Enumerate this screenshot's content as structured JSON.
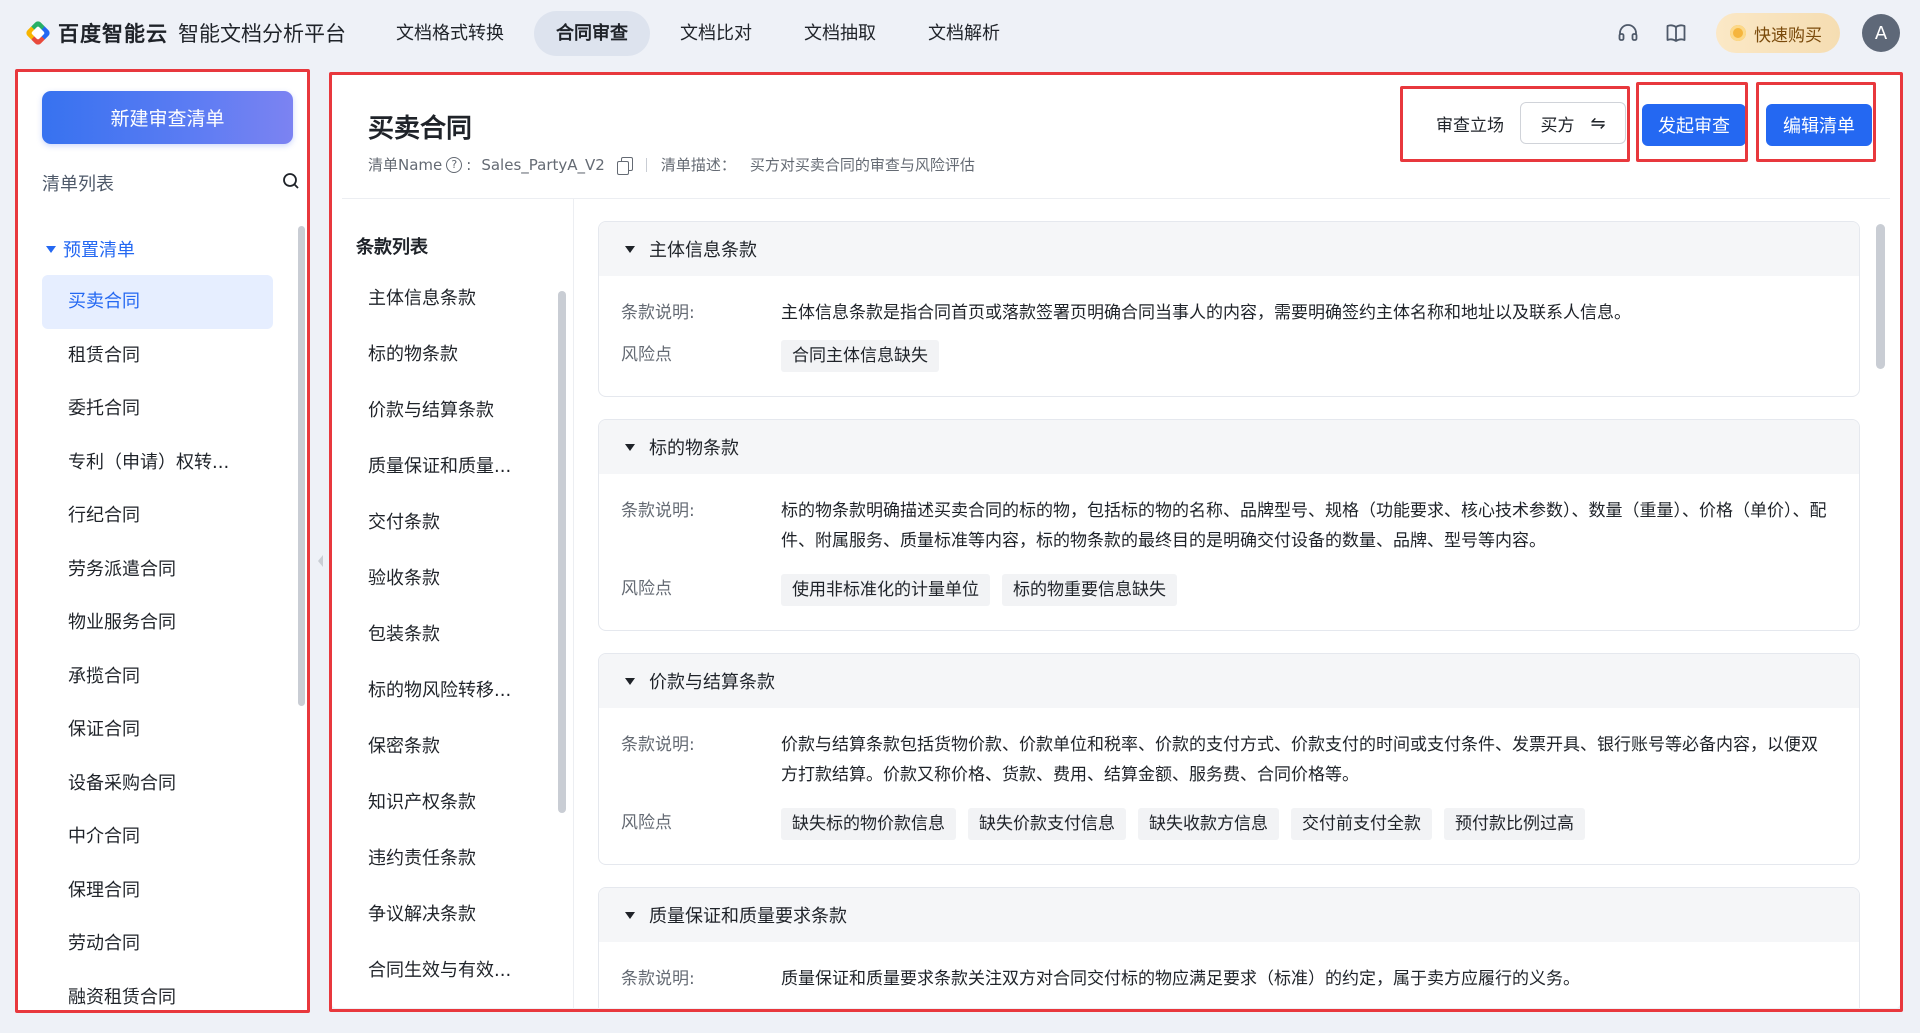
{
  "brand": {
    "name": "百度智能云",
    "product": "智能文档分析平台"
  },
  "nav": [
    "文档格式转换",
    "合同审查",
    "文档比对",
    "文档抽取",
    "文档解析"
  ],
  "top_right": {
    "buy_label": "快速购买",
    "avatar_letter": "A"
  },
  "sidebar": {
    "new_button": "新建审查清单",
    "list_title": "清单列表",
    "group": "预置清单",
    "items": [
      "买卖合同",
      "租赁合同",
      "委托合同",
      "专利（申请）权转...",
      "行纪合同",
      "劳务派遣合同",
      "物业服务合同",
      "承揽合同",
      "保证合同",
      "设备采购合同",
      "中介合同",
      "保理合同",
      "劳动合同",
      "融资租赁合同"
    ]
  },
  "main": {
    "title": "买卖合同",
    "name_label": "清单Name",
    "name_value": "Sales_PartyA_V2",
    "desc_label": "清单描述：",
    "desc_value": "买方对买卖合同的审查与风险评估",
    "stance_label": "审查立场",
    "stance_value": "买方",
    "stance_switch": "⇋",
    "review_button": "发起审查",
    "edit_button": "编辑清单"
  },
  "clause_nav": {
    "title": "条款列表",
    "items": [
      "主体信息条款",
      "标的物条款",
      "价款与结算条款",
      "质量保证和质量...",
      "交付条款",
      "验收条款",
      "包装条款",
      "标的物风险转移...",
      "保密条款",
      "知识产权条款",
      "违约责任条款",
      "争议解决条款",
      "合同生效与有效..."
    ]
  },
  "labels": {
    "desc": "条款说明:",
    "risk": "风险点"
  },
  "clauses": [
    {
      "title": "主体信息条款",
      "desc": "主体信息条款是指合同首页或落款签署页明确合同当事人的内容，需要明确签约主体名称和地址以及联系人信息。",
      "risks": [
        "合同主体信息缺失"
      ]
    },
    {
      "title": "标的物条款",
      "desc": "标的物条款明确描述买卖合同的标的物，包括标的物的名称、品牌型号、规格（功能要求、核心技术参数）、数量（重量）、价格（单价）、配件、附属服务、质量标准等内容，标的物条款的最终目的是明确交付设备的数量、品牌、型号等内容。",
      "risks": [
        "使用非标准化的计量单位",
        "标的物重要信息缺失"
      ]
    },
    {
      "title": "价款与结算条款",
      "desc": "价款与结算条款包括货物价款、价款单位和税率、价款的支付方式、价款支付的时间或支付条件、发票开具、银行账号等必备内容，以便双方打款结算。价款又称价格、货款、费用、结算金额、服务费、合同价格等。",
      "risks": [
        "缺失标的物价款信息",
        "缺失价款支付信息",
        "缺失收款方信息",
        "交付前支付全款",
        "预付款比例过高"
      ]
    },
    {
      "title": "质量保证和质量要求条款",
      "desc": "质量保证和质量要求条款关注双方对合同交付标的物应满足要求（标准）的约定，属于卖方应履行的义务。",
      "risks": []
    }
  ]
}
